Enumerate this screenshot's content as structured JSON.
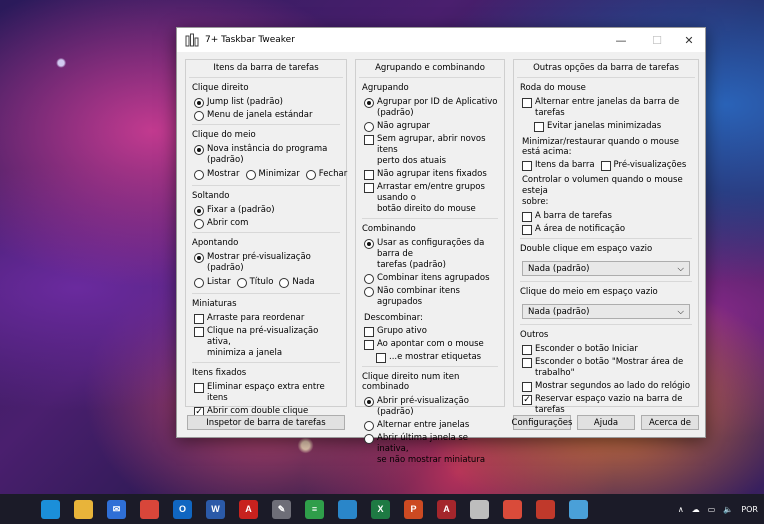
{
  "window": {
    "title": "7+ Taskbar Tweaker"
  },
  "col1": {
    "heading": "Itens da barra de tarefas",
    "clique_direito": {
      "title": "Clique direito",
      "opt1": "Jump list (padrão)",
      "opt2": "Menu de janela estándar"
    },
    "clique_meio": {
      "title": "Clique do meio",
      "opt1": "Nova instância do programa (padrão)",
      "opt2": "Mostrar",
      "opt3": "Minimizar",
      "opt4": "Fechar"
    },
    "soltando": {
      "title": "Soltando",
      "opt1": "Fixar a (padrão)",
      "opt2": "Abrir com"
    },
    "apontando": {
      "title": "Apontando",
      "opt1": "Mostrar pré-visualização (padrão)",
      "opt2": "Listar",
      "opt3": "Título",
      "opt4": "Nada"
    },
    "miniaturas": {
      "title": "Miniaturas",
      "opt1": "Arraste para reordenar",
      "opt2a": "Clique na pré-visualização ativa,",
      "opt2b": "minimiza a janela"
    },
    "fixados": {
      "title": "Itens fixados",
      "opt1": "Eliminar espaço extra entre itens",
      "opt2": "Abrir com double clique"
    }
  },
  "col2": {
    "heading": "Agrupando e combinando",
    "agrupando": {
      "title": "Agrupando",
      "opt1a": "Agrupar por ID de Aplicativo",
      "opt1b": "(padrão)",
      "opt2": "Não agrupar",
      "opt3a": "Sem agrupar, abrir novos itens",
      "opt3b": "perto dos atuais",
      "opt4": "Não agrupar itens fixados",
      "opt5a": "Arrastar em/entre grupos usando o",
      "opt5b": "botão direito do mouse"
    },
    "combinando": {
      "title": "Combinando",
      "opt1a": "Usar as configurações da barra de",
      "opt1b": "tarefas (padrão)",
      "opt2": "Combinar itens agrupados",
      "opt3": "Não combinar itens agrupados",
      "descombinar": "Descombinar:",
      "opt4": "Grupo ativo",
      "opt5": "Ao apontar com o mouse",
      "opt6": "...e mostrar etiquetas"
    },
    "clique_combinado": {
      "title": "Clique direito num iten combinado",
      "opt1": "Abrir pré-visualização (padrão)",
      "opt2": "Alternar entre janelas",
      "opt3a": "Abrir última janela se inativa,",
      "opt3b": "se não mostrar miniatura"
    }
  },
  "col3": {
    "heading": "Outras opções da barra de tarefas",
    "roda": {
      "title": "Roda do mouse",
      "opt1": "Alternar entre janelas da barra de tarefas",
      "opt2": "Evitar janelas minimizadas",
      "minimizar": "Minimizar/restaurar quando o mouse está acima:",
      "opt3": "Itens da barra",
      "opt4": "Pré-visualizações",
      "volume_a": "Controlar o volumen quando o mouse esteja",
      "volume_b": "sobre:",
      "opt5": "A barra de tarefas",
      "opt6": "A área de notificação"
    },
    "double": {
      "title": "Double clique em espaço vazio",
      "value": "Nada (padrão)"
    },
    "meio": {
      "title": "Clique do meio em espaço vazio",
      "value": "Nada (padrão)"
    },
    "outros": {
      "title": "Outros",
      "opt1": "Esconder o botão Iniciar",
      "opt2": "Esconder o botão \"Mostrar área de trabalho\"",
      "opt3": "Mostrar segundos ao lado do relógio",
      "opt4": "Reservar espaço vazio na barra de tarefas"
    }
  },
  "buttons": {
    "inspector": "Inspetor de barra de tarefas",
    "config": "Configurações",
    "help": "Ajuda",
    "about": "Acerca de"
  },
  "taskbar": {
    "icons": [
      {
        "name": "edge",
        "color": "#1b8fd9",
        "glyph": ""
      },
      {
        "name": "file-explorer",
        "color": "#e8b43a",
        "glyph": ""
      },
      {
        "name": "mail",
        "color": "#2f6fd6",
        "glyph": "✉"
      },
      {
        "name": "chrome",
        "color": "#d8463a",
        "glyph": ""
      },
      {
        "name": "outlook",
        "color": "#1066c1",
        "glyph": "O"
      },
      {
        "name": "word",
        "color": "#2b5aa8",
        "glyph": "W"
      },
      {
        "name": "acrobat",
        "color": "#c8221e",
        "glyph": "A"
      },
      {
        "name": "taskbar-tweaker",
        "color": "#6e6e78",
        "glyph": "✎"
      },
      {
        "name": "calculator-app",
        "color": "#2f9e4a",
        "glyph": "≡"
      },
      {
        "name": "photos",
        "color": "#2a86c9",
        "glyph": ""
      },
      {
        "name": "excel",
        "color": "#1e7a43",
        "glyph": "X"
      },
      {
        "name": "powerpoint",
        "color": "#cc4a22",
        "glyph": "P"
      },
      {
        "name": "access",
        "color": "#a4262c",
        "glyph": "A"
      },
      {
        "name": "clock-app",
        "color": "#bdbdbd",
        "glyph": ""
      },
      {
        "name": "globe-app",
        "color": "#d94b3a",
        "glyph": ""
      },
      {
        "name": "eye-app",
        "color": "#c0392b",
        "glyph": ""
      },
      {
        "name": "paint-app",
        "color": "#4aa0d8",
        "glyph": ""
      }
    ],
    "lang": "POR"
  }
}
